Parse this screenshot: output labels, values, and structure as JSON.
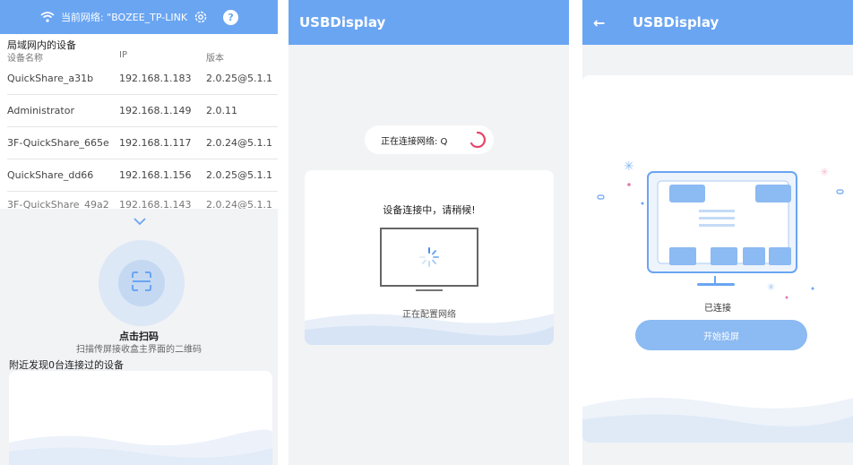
{
  "colors": {
    "accent": "#6aa5f2",
    "background": "#f2f3f5",
    "button": "#8cbaf2",
    "spinner": "#e4476b"
  },
  "panel1": {
    "topbar": {
      "network_label": "当前网络: \"BOZEE_TP-LINK",
      "icons": [
        "wifi-icon",
        "gear-icon",
        "help-icon"
      ],
      "help_symbol": "?"
    },
    "section_title": "局域网内的设备",
    "columns": {
      "name": "设备名称",
      "ip": "IP",
      "version": "版本"
    },
    "devices": [
      {
        "name": "QuickShare_a31b",
        "ip": "192.168.1.183",
        "version": "2.0.25@5.1.1"
      },
      {
        "name": "Administrator",
        "ip": "192.168.1.149",
        "version": "2.0.11"
      },
      {
        "name": "3F-QuickShare_665e",
        "ip": "192.168.1.117",
        "version": "2.0.24@5.1.1"
      },
      {
        "name": "QuickShare_dd66",
        "ip": "192.168.1.156",
        "version": "2.0.25@5.1.1"
      },
      {
        "name": "3F-QuickShare_49a2",
        "ip": "192.168.1.143",
        "version": "2.0.24@5.1.1"
      }
    ],
    "scan_title": "点击扫码",
    "scan_desc": "扫描传屏接收盒主界面的二维码",
    "nearby_label": "附近发现0台连接过的设备"
  },
  "panel2": {
    "app_title": "USBDisplay",
    "connecting_network_label": "正在连接网络: Q",
    "card_title": "设备连接中，请稍候!",
    "card_status": "正在配置网络"
  },
  "panel3": {
    "app_title": "USBDisplay",
    "back_symbol": "←",
    "status": "已连接",
    "start_button": "开始投屏"
  }
}
